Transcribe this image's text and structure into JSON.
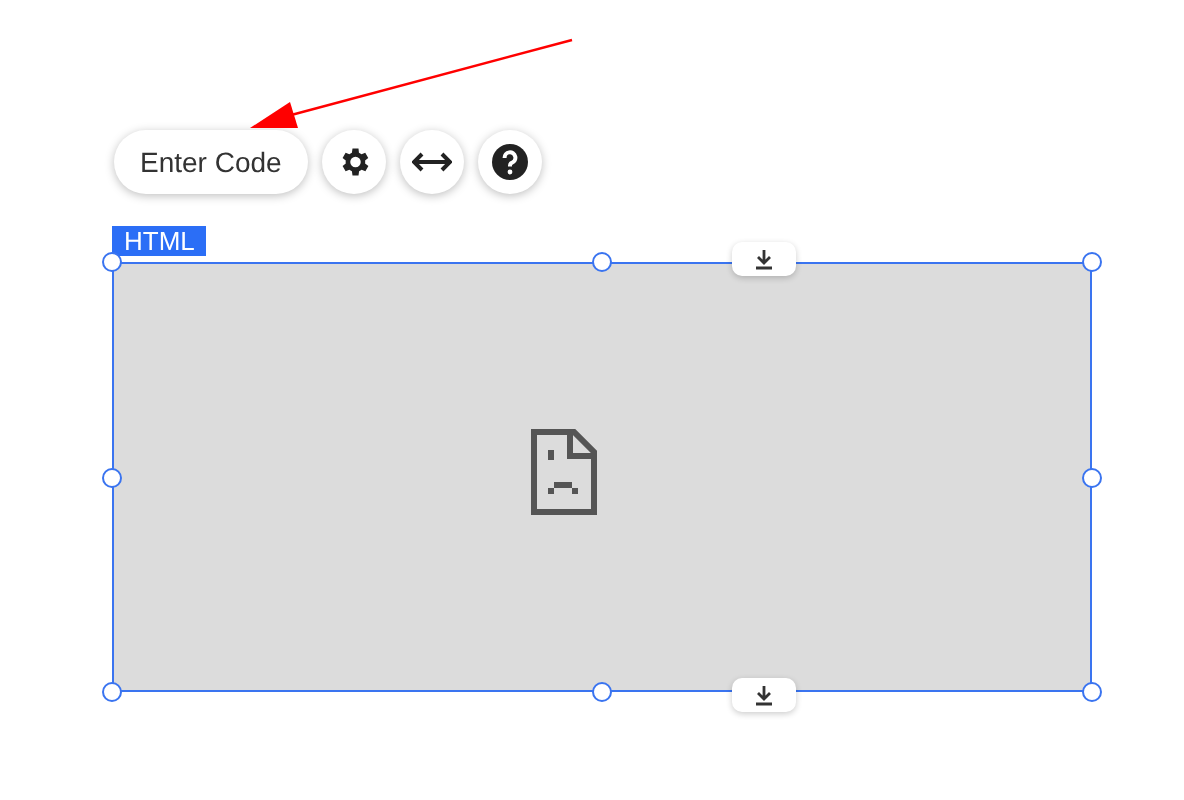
{
  "toolbar": {
    "enter_code_button": "Enter Code"
  },
  "element": {
    "type_label": "HTML"
  }
}
